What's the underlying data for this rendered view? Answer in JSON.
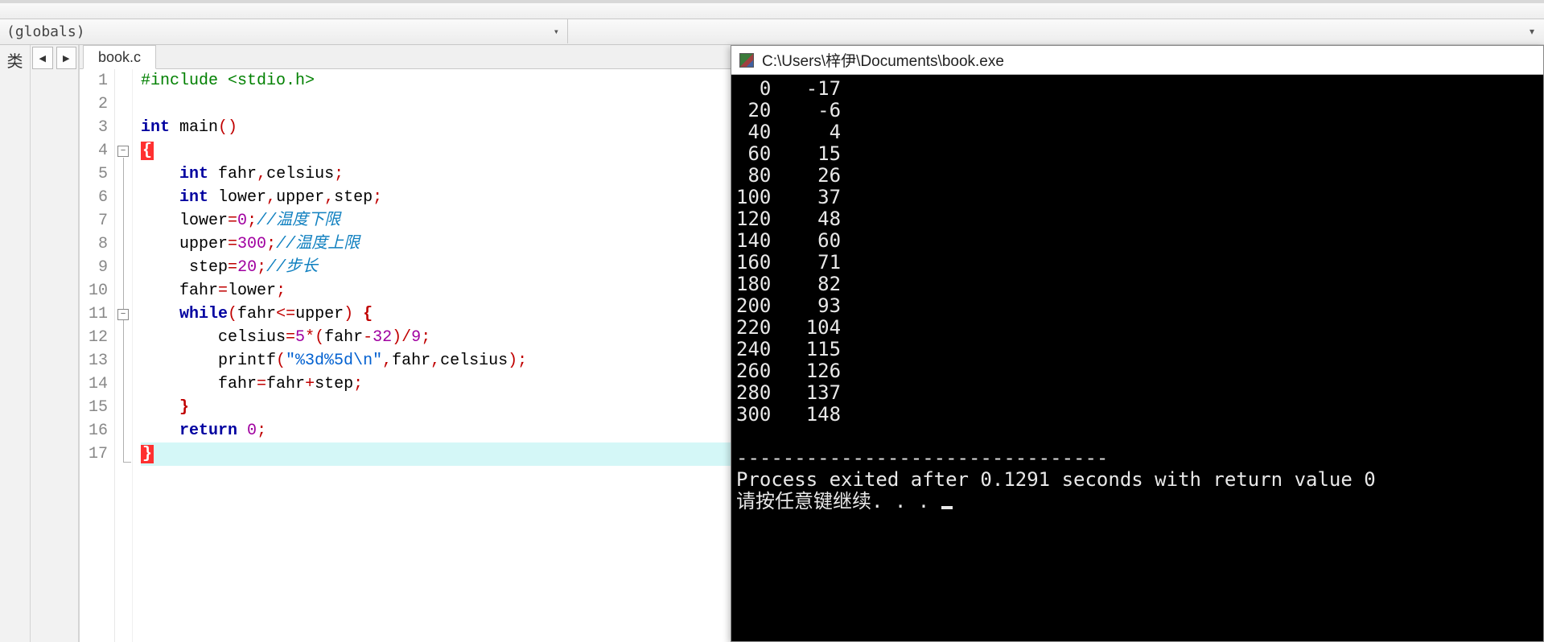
{
  "toolbar": {
    "scope_label": "(globals)"
  },
  "side_label": "类",
  "nav": {
    "back": "◀",
    "fwd": "▶"
  },
  "tabs": [
    {
      "label": "book.c"
    }
  ],
  "code": {
    "lines": [
      1,
      2,
      3,
      4,
      5,
      6,
      7,
      8,
      9,
      10,
      11,
      12,
      13,
      14,
      15,
      16,
      17
    ],
    "fold_minus_rows": [
      4,
      11
    ],
    "content": {
      "l1_pre": "#include ",
      "l1_inc": "<stdio.h>",
      "l3_kw1": "int",
      "l3_fn": " main",
      "l3_par": "()",
      "l4_brace": "{",
      "l5_kw": "int",
      "l5_rest": " fahr",
      "l5_c1": ",",
      "l5_r2": "celsius",
      "l5_sc": ";",
      "l6_kw": "int",
      "l6_a": " lower",
      "l6_c1": ",",
      "l6_b": "upper",
      "l6_c2": ",",
      "l6_c": "step",
      "l6_sc": ";",
      "l7_a": "lower",
      "l7_eq": "=",
      "l7_n": "0",
      "l7_sc": ";",
      "l7_cmt": "//温度下限",
      "l8_a": "upper",
      "l8_eq": "=",
      "l8_n": "300",
      "l8_sc": ";",
      "l8_cmt": "//温度上限",
      "l9_pre": " ",
      "l9_a": "step",
      "l9_eq": "=",
      "l9_n": "20",
      "l9_sc": ";",
      "l9_cmt": "//步长",
      "l10_a": "fahr",
      "l10_eq": "=",
      "l10_b": "lower",
      "l10_sc": ";",
      "l11_kw": "while",
      "l11_p1": "(",
      "l11_a": "fahr",
      "l11_op": "<=",
      "l11_b": "upper",
      "l11_p2": ")",
      "l11_sp": " ",
      "l11_br": "{",
      "l12_a": "celsius",
      "l12_eq": "=",
      "l12_n5": "5",
      "l12_mul": "*",
      "l12_p1": "(",
      "l12_f": "fahr",
      "l12_minus": "-",
      "l12_n32": "32",
      "l12_p2": ")",
      "l12_div": "/",
      "l12_n9": "9",
      "l12_sc": ";",
      "l13_fn": "printf",
      "l13_p1": "(",
      "l13_str": "\"%3d%5d\\n\"",
      "l13_c1": ",",
      "l13_a": "fahr",
      "l13_c2": ",",
      "l13_b": "celsius",
      "l13_p2": ")",
      "l13_sc": ";",
      "l14_a": "fahr",
      "l14_eq": "=",
      "l14_b": "fahr",
      "l14_plus": "+",
      "l14_c": "step",
      "l14_sc": ";",
      "l15_br": "}",
      "l16_kw": "return",
      "l16_sp": " ",
      "l16_n": "0",
      "l16_sc": ";",
      "l17_brace": "}"
    }
  },
  "console": {
    "title": "C:\\Users\\梓伊\\Documents\\book.exe",
    "output": [
      "  0   -17",
      " 20    -6",
      " 40     4",
      " 60    15",
      " 80    26",
      "100    37",
      "120    48",
      "140    60",
      "160    71",
      "180    82",
      "200    93",
      "220   104",
      "240   115",
      "260   126",
      "280   137",
      "300   148"
    ],
    "separator": "--------------------------------",
    "exit_msg": "Process exited after 0.1291 seconds with return value 0",
    "pause_msg": "请按任意键继续. . . "
  }
}
